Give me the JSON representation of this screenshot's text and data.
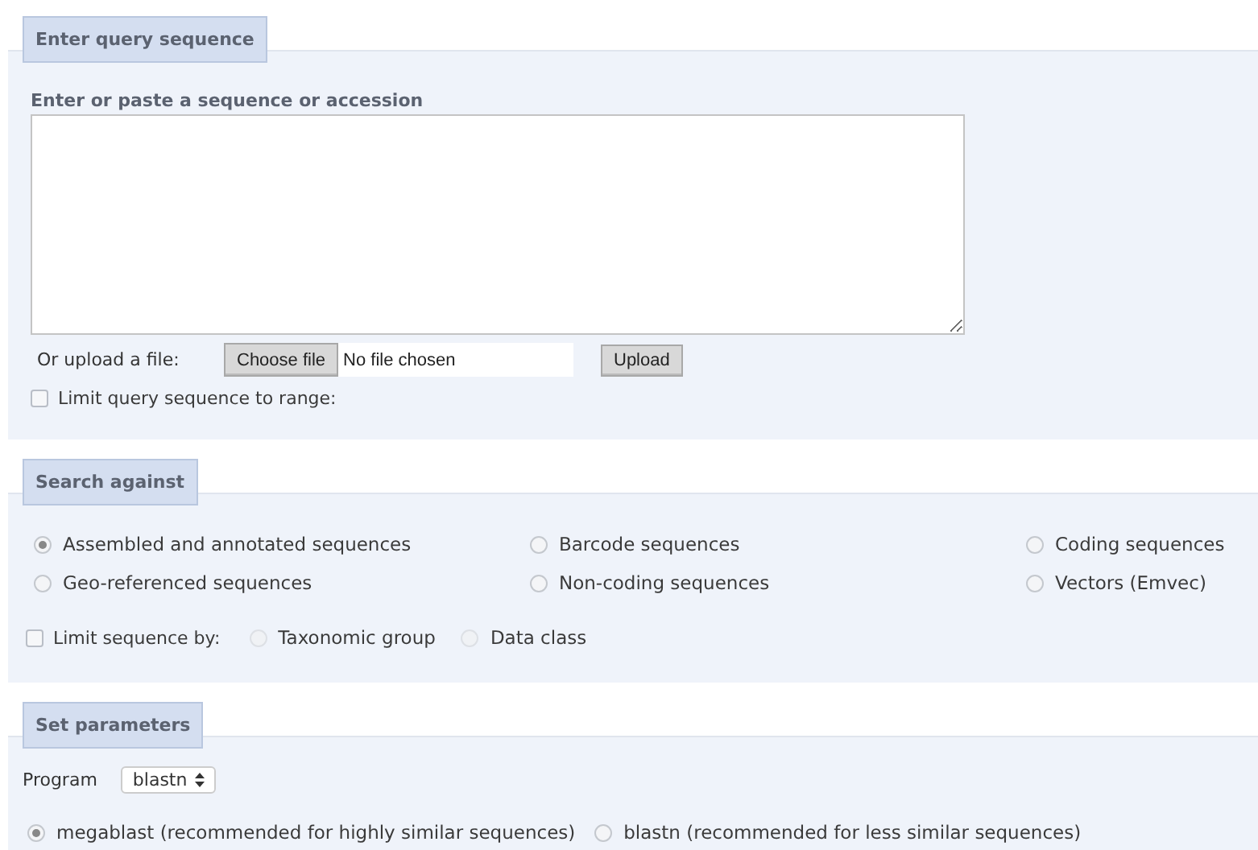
{
  "query": {
    "title": "Enter query sequence",
    "label": "Enter or paste a sequence or accession",
    "upload_label": "Or upload a file:",
    "choose_file_button": "Choose file",
    "file_status": "No file chosen",
    "upload_button": "Upload",
    "limit_range": {
      "label": "Limit query sequence to range:",
      "checked": false
    }
  },
  "search_against": {
    "title": "Search against",
    "databases": [
      {
        "label": "Assembled and annotated sequences",
        "selected": true
      },
      {
        "label": "Barcode sequences",
        "selected": false
      },
      {
        "label": "Coding sequences",
        "selected": false
      },
      {
        "label": "Geo-referenced sequences",
        "selected": false
      },
      {
        "label": "Non-coding sequences",
        "selected": false
      },
      {
        "label": "Vectors (Emvec)",
        "selected": false
      }
    ],
    "limit": {
      "label": "Limit sequence by:",
      "checked": false,
      "options": [
        {
          "label": "Taxonomic group",
          "selected": false,
          "disabled": true
        },
        {
          "label": "Data class",
          "selected": false,
          "disabled": true
        }
      ]
    }
  },
  "parameters": {
    "title": "Set parameters",
    "program_label": "Program",
    "program_value": "blastn",
    "algorithms": [
      {
        "label": "megablast (recommended for highly similar sequences)",
        "selected": true
      },
      {
        "label": "blastn (recommended for less similar sequences)",
        "selected": false
      }
    ]
  }
}
